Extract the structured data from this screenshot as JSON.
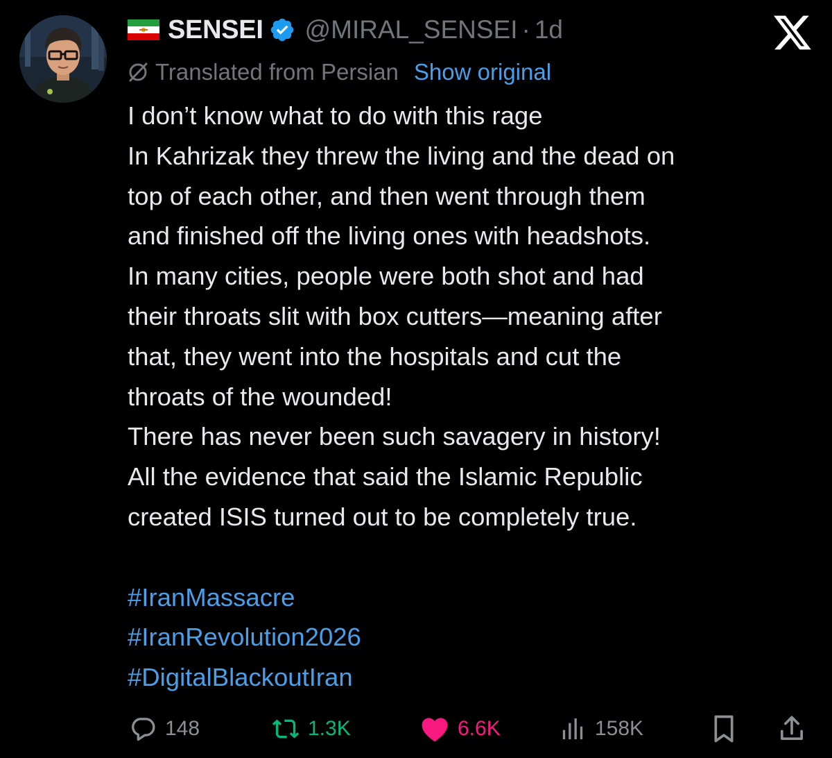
{
  "author": {
    "display_name": "SENSEI",
    "handle": "@MIRAL_SENSEI",
    "separator": "·",
    "time_ago": "1d",
    "flag_icon": "iran-lion-and-sun-flag",
    "verified": true,
    "verified_color": "#1d9bf0"
  },
  "translation": {
    "label": "Translated from Persian",
    "show_original": "Show original"
  },
  "tweet": {
    "lines": [
      "I don’t know what to do with this rage",
      "In Kahrizak they threw the living and the dead on",
      "top of each other, and then went through them",
      "and finished off the living ones with headshots.",
      "In many cities, people were both shot and had",
      "their throats slit with box cutters—meaning after",
      "that, they went into the hospitals and cut the",
      "throats of the wounded!",
      "There has never been such savagery in history!",
      "All the evidence that said the Islamic Republic",
      "created ISIS turned out to be completely true."
    ],
    "hashtags": [
      "#IranMassacre",
      "#IranRevolution2026",
      "#DigitalBlackoutIran"
    ]
  },
  "actions": {
    "replies": "148",
    "reposts": "1.3K",
    "likes": "6.6K",
    "views": "158K"
  },
  "colors": {
    "background": "#000000",
    "text": "#e7e9ea",
    "muted": "#71767b",
    "link": "#4a9fe8",
    "repost": "#00ba7c",
    "like": "#f91880"
  }
}
